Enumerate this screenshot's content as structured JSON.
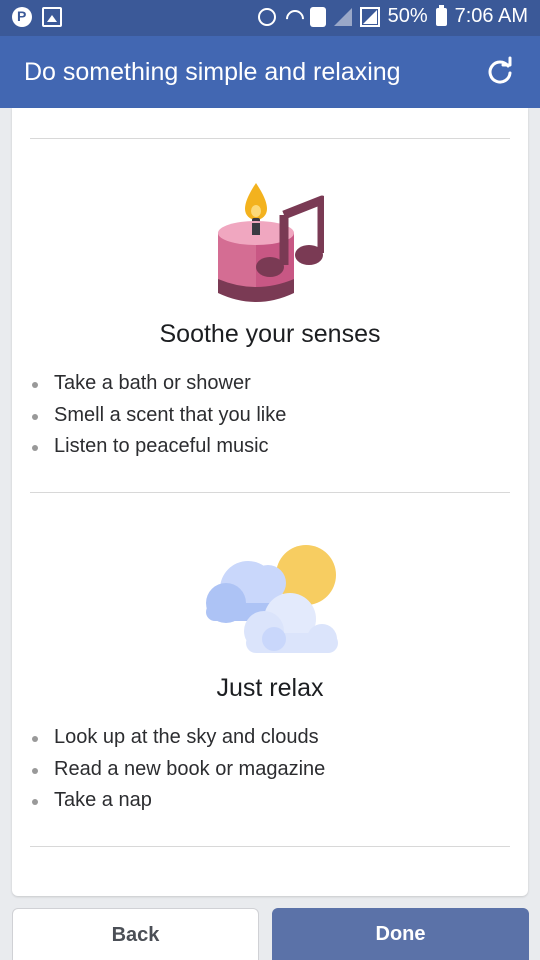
{
  "status_bar": {
    "battery": "50%",
    "time": "7:06 AM",
    "icons": [
      "pinterest-icon",
      "gallery-icon",
      "alarm-icon",
      "wifi-icon",
      "phone-icon",
      "signal-icon",
      "battery-icon"
    ]
  },
  "header": {
    "title": "Do something simple and relaxing",
    "refresh_icon": "refresh-icon"
  },
  "sections": [
    {
      "icon": "candle-music-icon",
      "title": "Soothe your senses",
      "tips": [
        "Take a bath or shower",
        "Smell a scent that you like",
        "Listen to peaceful music"
      ]
    },
    {
      "icon": "sun-clouds-icon",
      "title": "Just relax",
      "tips": [
        "Look up at the sky and clouds",
        "Read a new book or magazine",
        "Take a nap"
      ]
    }
  ],
  "footer": {
    "back_label": "Back",
    "done_label": "Done"
  },
  "colors": {
    "brand": "#3b5998",
    "appbar": "#4267b2",
    "done_button": "#5b72a8",
    "candle": "#d46d93",
    "music_note": "#7a3a54",
    "sun": "#f7cd61",
    "cloud": "#c9d7fb"
  }
}
